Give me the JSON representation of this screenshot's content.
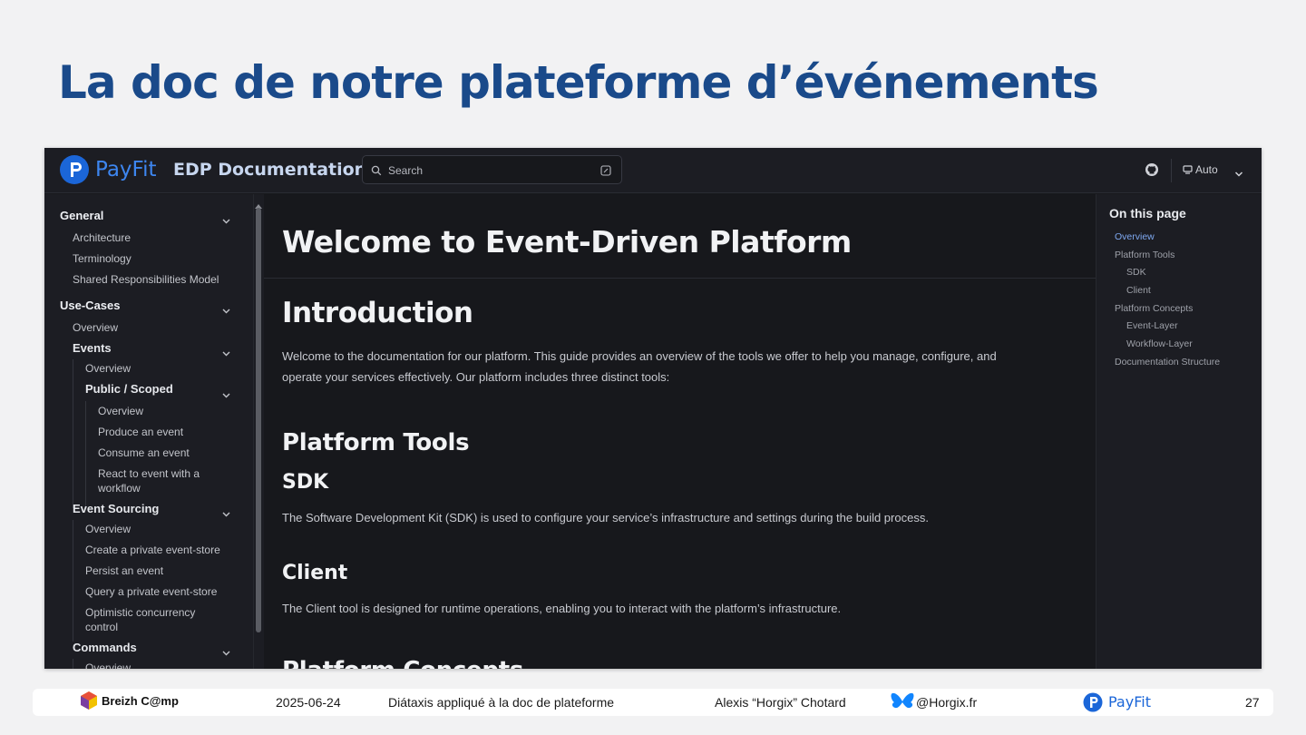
{
  "slide": {
    "title": "La doc de notre plateforme d’événements"
  },
  "app": {
    "brand": "PayFit",
    "doc_title": "EDP Documentation",
    "search_placeholder": "Search",
    "theme_label": "Auto"
  },
  "sidebar": {
    "items": [
      {
        "label": "General",
        "kind": "section",
        "expanded": true
      },
      {
        "label": "Architecture"
      },
      {
        "label": "Terminology"
      },
      {
        "label": "Shared Responsibilities Model"
      },
      {
        "label": "Use-Cases",
        "kind": "section",
        "expanded": true
      },
      {
        "label": "Overview"
      },
      {
        "label": "Events",
        "kind": "subsection",
        "expanded": true
      },
      {
        "label": "Overview"
      },
      {
        "label": "Public / Scoped",
        "kind": "subsection",
        "expanded": true
      },
      {
        "label": "Overview"
      },
      {
        "label": "Produce an event"
      },
      {
        "label": "Consume an event"
      },
      {
        "label": "React to event with a"
      },
      {
        "label": "workflow"
      },
      {
        "label": "Event Sourcing",
        "kind": "subsection",
        "expanded": true
      },
      {
        "label": "Overview"
      },
      {
        "label": "Create a private event-store"
      },
      {
        "label": "Persist an event"
      },
      {
        "label": "Query a private event-store"
      },
      {
        "label": "Optimistic concurrency"
      },
      {
        "label": "control"
      },
      {
        "label": "Commands",
        "kind": "subsection",
        "expanded": true
      },
      {
        "label": "Overview"
      }
    ]
  },
  "content": {
    "page_title": "Welcome to Event-Driven Platform",
    "intro_heading": "Introduction",
    "intro_line1": "Welcome to the documentation for our platform. This guide provides an overview of the tools we offer to help you manage, configure, and",
    "intro_line2": "operate your services effectively. Our platform includes three distinct tools:",
    "tools_heading": "Platform Tools",
    "sdk_heading": "SDK",
    "sdk_text": "The Software Development Kit (SDK) is used to configure your service’s infrastructure and settings during the build process.",
    "client_heading": "Client",
    "client_text": "The Client tool is designed for runtime operations, enabling you to interact with the platform’s infrastructure.",
    "concepts_heading": "Platform Concepts"
  },
  "toc": {
    "title": "On this page",
    "items": [
      {
        "label": "Overview",
        "active": true
      },
      {
        "label": "Platform Tools"
      },
      {
        "label": "SDK"
      },
      {
        "label": "Client"
      },
      {
        "label": "Platform Concepts"
      },
      {
        "label": "Event-Layer"
      },
      {
        "label": "Workflow-Layer"
      },
      {
        "label": "Documentation Structure"
      }
    ]
  },
  "footer": {
    "conference": "Breizh C@mp",
    "date": "2025-06-24",
    "talk_title": "Diátaxis appliqué à la doc de plateforme",
    "speaker": "Alexis “Horgix” Chotard",
    "handle": "@Horgix.fr",
    "company": "PayFit",
    "page_number": "27"
  },
  "colors": {
    "title_blue": "#1a4a8a",
    "payfit_blue": "#1b66d8",
    "toc_active": "#7ea8f0"
  }
}
